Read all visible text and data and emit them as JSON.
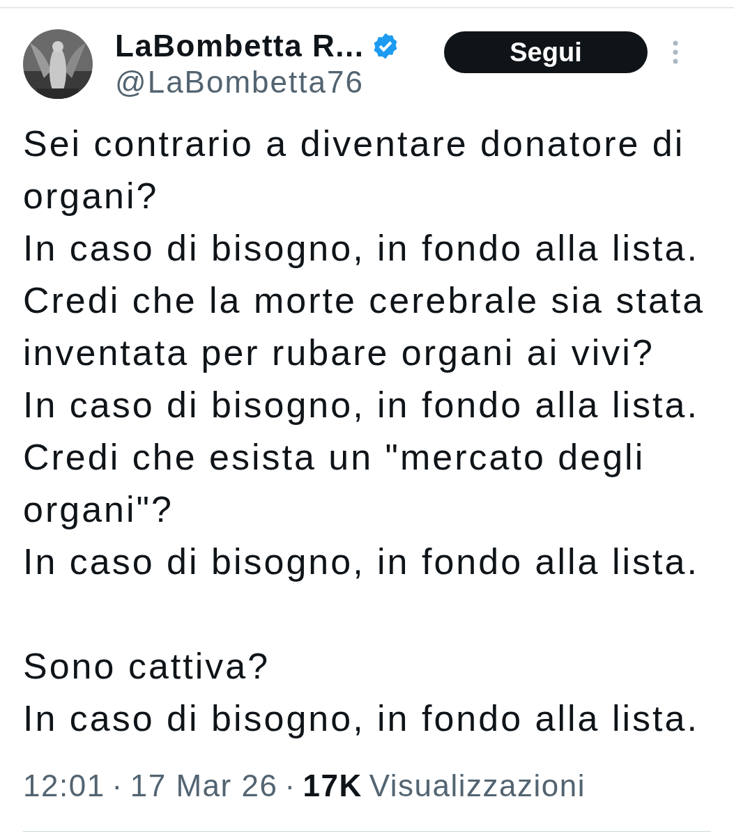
{
  "author": {
    "name": "LaBombetta R...",
    "verified": true,
    "handle": "@LaBombetta76"
  },
  "follow_button": {
    "label": "Segui"
  },
  "body": {
    "paragraphs": [
      [
        "Sei contrario a diventare donatore di",
        "organi?",
        "In caso di bisogno, in fondo alla lista.",
        "Credi che la morte cerebrale sia stata",
        "inventata per rubare organi ai vivi?",
        "In caso di bisogno, in fondo alla lista.",
        "Credi che esista un \"mercato degli",
        "organi\"?",
        "In caso di bisogno, in fondo alla lista."
      ],
      [
        "Sono cattiva?",
        "In caso di bisogno, in fondo alla lista."
      ]
    ]
  },
  "meta": {
    "time": "12:01",
    "separator_1": "·",
    "date": "17 Mar 26",
    "separator_2": "·",
    "views": "17K",
    "views_label": "Visualizzazioni"
  }
}
